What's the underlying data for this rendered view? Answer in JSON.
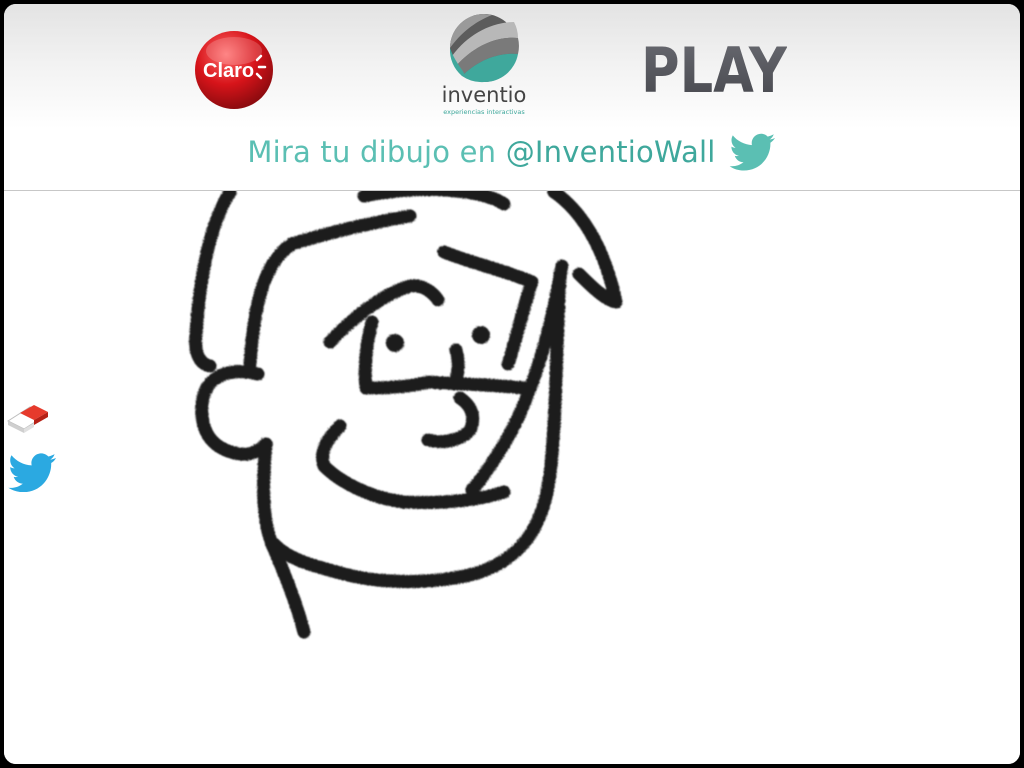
{
  "header": {
    "logos": [
      {
        "name": "claro-logo",
        "text": "Claro",
        "color": "#d7141a"
      },
      {
        "name": "inventio-logo",
        "text": "inventio",
        "subtext": "experiencias interactivas",
        "color": "#3fa89c"
      },
      {
        "name": "play-logo",
        "text": "PLAY",
        "color": "#55565c"
      }
    ],
    "tagline": {
      "text": "Mira tu dibujo en ",
      "handle": "@InventioWall",
      "icon": "twitter-bird-icon",
      "color": "#5bbfb3"
    }
  },
  "toolbar": {
    "tools": [
      {
        "name": "eraser-button",
        "icon": "eraser-icon"
      },
      {
        "name": "tweet-button",
        "icon": "twitter-bird-icon",
        "color": "#2ba9e1"
      }
    ]
  },
  "canvas": {
    "content": "freehand-sketch",
    "stroke_color": "#1a1a1a",
    "background": "#ffffff"
  }
}
